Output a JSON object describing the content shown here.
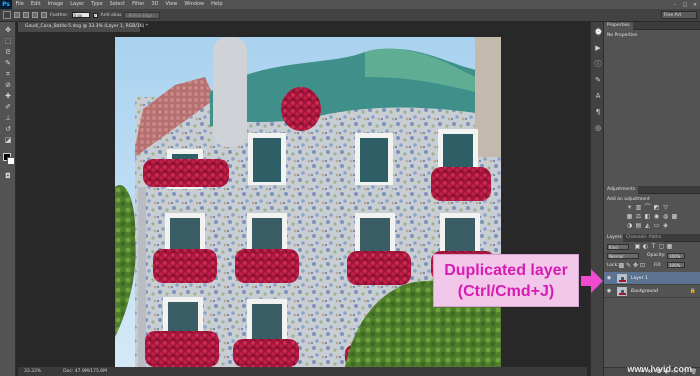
{
  "app": {
    "logo": "Ps",
    "workspace": "Fine Art"
  },
  "menu": [
    "File",
    "Edit",
    "Image",
    "Layer",
    "Type",
    "Select",
    "Filter",
    "3D",
    "View",
    "Window",
    "Help"
  ],
  "window_controls": [
    "–",
    "□",
    "×"
  ],
  "options_bar": {
    "feather_label": "Feather:",
    "feather_value": "0 px",
    "antialias_label": "Anti-alias",
    "refine_edge": "Refine Edge..."
  },
  "document": {
    "tab_title": "Gaudi_Casa_Batllo-5.dng @ 33.3% (Layer 1, RGB/16) *",
    "zoom": "33.33%",
    "doc_size": "Doc: 47.9M/175.6M"
  },
  "properties_panel": {
    "title": "Properties",
    "empty_text": "No Properties"
  },
  "adjustments_panel": {
    "title": "Adjustments",
    "subtitle": "Add an adjustment"
  },
  "layers_panel": {
    "tabs": [
      "Layers",
      "Channels",
      "Paths"
    ],
    "kind_filter": "Kind",
    "blend_mode": "Normal",
    "opacity_label": "Opacity:",
    "opacity_value": "100%",
    "lock_label": "Lock:",
    "fill_label": "Fill:",
    "fill_value": "100%",
    "layers": [
      {
        "name": "Layer 1",
        "selected": true
      },
      {
        "name": "Background",
        "selected": false
      }
    ]
  },
  "annotation": {
    "line1": "Duplicated layer",
    "line2": "(Ctrl/Cmd+J)"
  },
  "watermark": "www.lvvid.com",
  "colors": {
    "accent": "#d81bb3",
    "callout_bg": "#f2c8ea",
    "selected_layer": "#5d7392"
  }
}
